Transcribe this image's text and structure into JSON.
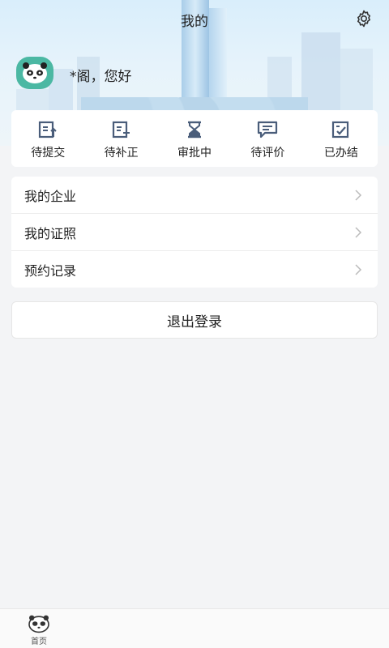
{
  "header": {
    "title": "我的"
  },
  "user": {
    "greeting": "*阁，您好"
  },
  "status": [
    {
      "label": "待提交",
      "icon": "doc-upload-icon"
    },
    {
      "label": "待补正",
      "icon": "doc-add-icon"
    },
    {
      "label": "审批中",
      "icon": "hourglass-icon"
    },
    {
      "label": "待评价",
      "icon": "comment-icon"
    },
    {
      "label": "已办结",
      "icon": "doc-check-icon"
    }
  ],
  "menu": [
    {
      "label": "我的企业"
    },
    {
      "label": "我的证照"
    },
    {
      "label": "预约记录"
    }
  ],
  "logout": {
    "label": "退出登录"
  },
  "tabbar": {
    "home_label": "首页"
  },
  "colors": {
    "icon": "#4a5d7a",
    "avatar": "#4bb8a3",
    "background": "#f3f4f6"
  }
}
